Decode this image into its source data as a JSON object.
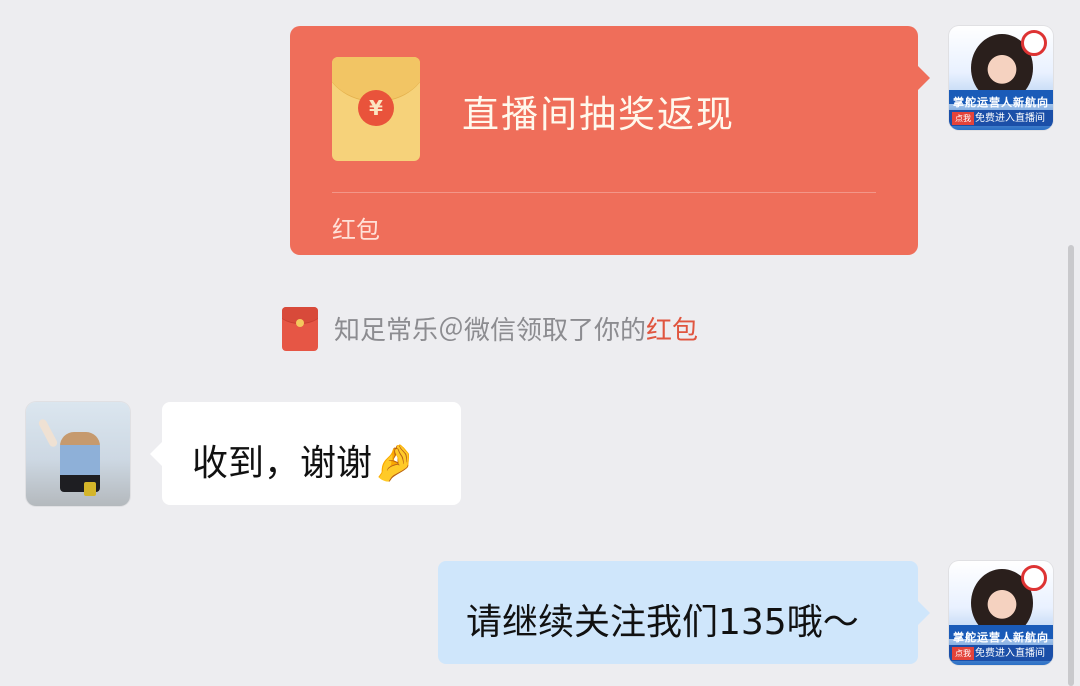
{
  "red_packet": {
    "title": "直播间抽奖返现",
    "label": "红包",
    "coin_symbol": "¥",
    "color": "#ef6e5a"
  },
  "notice": {
    "text": "知足常乐＠微信领取了你的",
    "link": "红包",
    "link_color": "#e0553f"
  },
  "messages": {
    "incoming": {
      "text": "收到，谢谢",
      "emoji": "🤌"
    },
    "outgoing": {
      "text": "请继续关注我们135哦～"
    }
  },
  "avatar_self": {
    "banner_line1": "掌舵运营人新航向",
    "banner_tag": "点我",
    "banner_line2": "免费进入直播间"
  },
  "colors": {
    "background": "#ededf0",
    "outgoing_bubble": "#cfe6fb",
    "incoming_bubble": "#ffffff"
  }
}
